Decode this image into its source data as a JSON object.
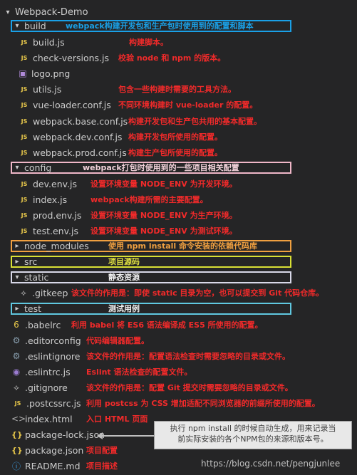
{
  "explorer": {
    "root": "Webpack-Demo",
    "folders": {
      "build": "build",
      "config": "config",
      "node_modules": "node_modules",
      "src": "src",
      "static": "static",
      "test": "test"
    },
    "files": [
      {
        "name": "build.js",
        "note": "构建脚本。"
      },
      {
        "name": "check-versions.js",
        "note": "校验 node 和 npm 的版本。"
      },
      {
        "name": "logo.png",
        "note": ""
      },
      {
        "name": "utils.js",
        "note": "包含一些构建时需要的工具方法。"
      },
      {
        "name": "vue-loader.conf.js",
        "note": "不同环境构建时 vue-loader 的配置。"
      },
      {
        "name": "webpack.base.conf.js",
        "note": "构建开发包和生产包共用的基本配置。"
      },
      {
        "name": "webpack.dev.conf.js",
        "note": "构建开发包所使用的配置。"
      },
      {
        "name": "webpack.prod.conf.js",
        "note": "构建生产包所使用的配置。"
      },
      {
        "name": "dev.env.js",
        "note": "设置环境变量 NODE_ENV 为开发环境。"
      },
      {
        "name": "index.js",
        "note": "webpack构建所需的主要配置。"
      },
      {
        "name": "prod.env.js",
        "note": "设置环境变量 NODE_ENV 为生产环境。"
      },
      {
        "name": "test.env.js",
        "note": "设置环境变量 NODE_ENV 为测试环境。"
      },
      {
        "name": ".gitkeep",
        "note": "该文件的作用是：即使 static 目录为空，也可以提交到 Git 代码仓库。"
      },
      {
        "name": ".babelrc",
        "note": "利用 babel 将 ES6 语法编译成 ES5 所使用的配置。"
      },
      {
        "name": ".editorconfig",
        "note": "代码编辑器配置。"
      },
      {
        "name": ".eslintignore",
        "note": "该文件的作用是：配置语法检查时需要忽略的目录或文件。"
      },
      {
        "name": ".eslintrc.js",
        "note": "Eslint 语法检查的配置文件。"
      },
      {
        "name": ".gitignore",
        "note": "该文件的作用是：配置 Git 提交时需要忽略的目录或文件。"
      },
      {
        "name": ".postcssrc.js",
        "note": "利用 postcss 为 CSS 增加适配不同浏览器的前缀所使用的配置。"
      },
      {
        "name": "index.html",
        "note": "入口 HTML 页面"
      },
      {
        "name": "package-lock.json",
        "note": ""
      },
      {
        "name": "package.json",
        "note": "项目配置"
      },
      {
        "name": "README.md",
        "note": "项目描述"
      }
    ],
    "folder_notes": {
      "build": "webpack构建开发包和生产包时使用到的配置和脚本",
      "config": "webpack打包时使用到的一些项目相关配置",
      "node_modules": "使用 npm install 命令安装的依赖代码库",
      "src": "项目源码",
      "static": "静态资源",
      "test": "测试用例"
    },
    "tooltip_line1": "执行 npm install 的时候自动生成，用来记录当",
    "tooltip_line2": "前实际安装的各个NPM包的来源和版本号。",
    "watermark": "https://blog.csdn.net/pengjunlee"
  }
}
